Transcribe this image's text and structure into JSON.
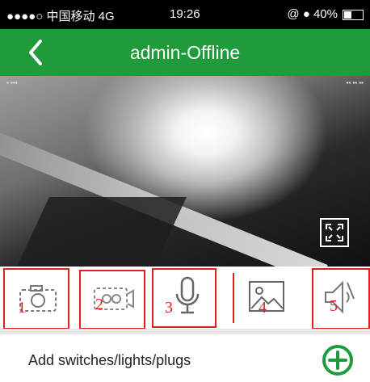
{
  "status_bar": {
    "carrier": "●●●●○ 中国移动  4G",
    "time": "19:26",
    "right": "@ ● 40%",
    "battery_level": 0.4
  },
  "header": {
    "back_icon": "chevron-left-icon",
    "title": "admin-Offline"
  },
  "video": {
    "fullscreen_icon": "fullscreen-icon"
  },
  "toolbar": {
    "items": [
      {
        "icon": "camera-snapshot-icon",
        "number": "1"
      },
      {
        "icon": "video-record-icon",
        "number": "2"
      },
      {
        "icon": "microphone-icon",
        "number": "3"
      },
      {
        "icon": "image-gallery-icon",
        "number": "4"
      },
      {
        "icon": "speaker-muted-icon",
        "number": "5"
      }
    ],
    "highlight_color": "#e02020"
  },
  "add_row": {
    "label": "Add switches/lights/plugs",
    "icon": "plus-circle-icon"
  },
  "colors": {
    "header_bg": "#1f9b3b",
    "accent": "#1f9b3b"
  }
}
